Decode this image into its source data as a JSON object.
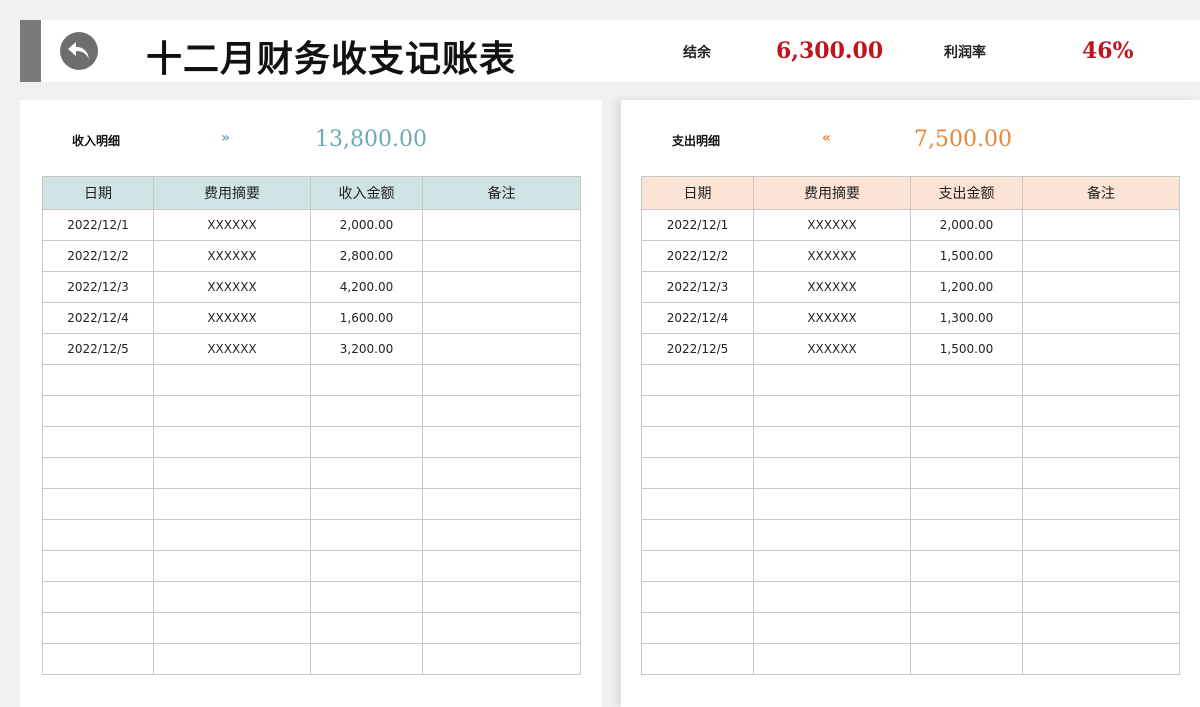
{
  "header": {
    "title": "十二月财务收支记账表",
    "balance_label": "结余",
    "balance_value": "6,300.00",
    "profit_rate_label": "利润率",
    "profit_rate_value": "46%"
  },
  "colors": {
    "accent_red": "#c0141c",
    "income_header": "#d0e3e5",
    "income_accent": "#6aaab5",
    "expense_header": "#fbe3d5",
    "expense_accent": "#e8873a"
  },
  "icons": {
    "back": "back-arrow-icon",
    "income_arrow": "double-chevron-right-icon",
    "expense_arrow": "double-chevron-left-icon"
  },
  "income": {
    "label": "收入明细",
    "arrow": "»",
    "total": "13,800.00",
    "columns": [
      "日期",
      "费用摘要",
      "收入金额",
      "备注"
    ],
    "rows": [
      [
        "2022/12/1",
        "XXXXXX",
        "2,000.00",
        ""
      ],
      [
        "2022/12/2",
        "XXXXXX",
        "2,800.00",
        ""
      ],
      [
        "2022/12/3",
        "XXXXXX",
        "4,200.00",
        ""
      ],
      [
        "2022/12/4",
        "XXXXXX",
        "1,600.00",
        ""
      ],
      [
        "2022/12/5",
        "XXXXXX",
        "3,200.00",
        ""
      ],
      [
        "",
        "",
        "",
        ""
      ],
      [
        "",
        "",
        "",
        ""
      ],
      [
        "",
        "",
        "",
        ""
      ],
      [
        "",
        "",
        "",
        ""
      ],
      [
        "",
        "",
        "",
        ""
      ],
      [
        "",
        "",
        "",
        ""
      ],
      [
        "",
        "",
        "",
        ""
      ],
      [
        "",
        "",
        "",
        ""
      ],
      [
        "",
        "",
        "",
        ""
      ],
      [
        "",
        "",
        "",
        ""
      ]
    ]
  },
  "expense": {
    "label": "支出明细",
    "arrow": "«",
    "total": "7,500.00",
    "columns": [
      "日期",
      "费用摘要",
      "支出金额",
      "备注"
    ],
    "rows": [
      [
        "2022/12/1",
        "XXXXXX",
        "2,000.00",
        ""
      ],
      [
        "2022/12/2",
        "XXXXXX",
        "1,500.00",
        ""
      ],
      [
        "2022/12/3",
        "XXXXXX",
        "1,200.00",
        ""
      ],
      [
        "2022/12/4",
        "XXXXXX",
        "1,300.00",
        ""
      ],
      [
        "2022/12/5",
        "XXXXXX",
        "1,500.00",
        ""
      ],
      [
        "",
        "",
        "",
        ""
      ],
      [
        "",
        "",
        "",
        ""
      ],
      [
        "",
        "",
        "",
        ""
      ],
      [
        "",
        "",
        "",
        ""
      ],
      [
        "",
        "",
        "",
        ""
      ],
      [
        "",
        "",
        "",
        ""
      ],
      [
        "",
        "",
        "",
        ""
      ],
      [
        "",
        "",
        "",
        ""
      ],
      [
        "",
        "",
        "",
        ""
      ],
      [
        "",
        "",
        "",
        ""
      ]
    ]
  }
}
